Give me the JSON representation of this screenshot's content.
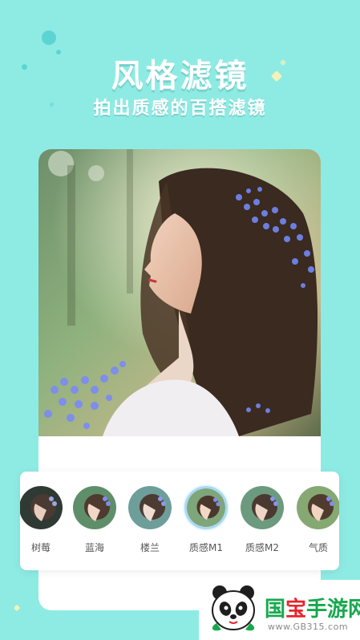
{
  "header": {
    "title": "风格滤镜",
    "subtitle": "拍出质感的百搭滤镜"
  },
  "filters": [
    {
      "label": "树莓",
      "selected": false
    },
    {
      "label": "蓝海",
      "selected": false
    },
    {
      "label": "楼兰",
      "selected": false
    },
    {
      "label": "质感M1",
      "selected": true
    },
    {
      "label": "质感M2",
      "selected": false
    },
    {
      "label": "气质",
      "selected": false
    }
  ],
  "watermark": {
    "brand_part1": "国",
    "brand_part2": "宝",
    "brand_part3": "手游网",
    "site": "www.GB315.com"
  },
  "colors": {
    "background": "#8EEBE4",
    "accent_bubble": "#57D1CF",
    "selected_ring": "#A9D9F2",
    "brand_green": "#17A84D",
    "brand_red": "#E8242B"
  }
}
